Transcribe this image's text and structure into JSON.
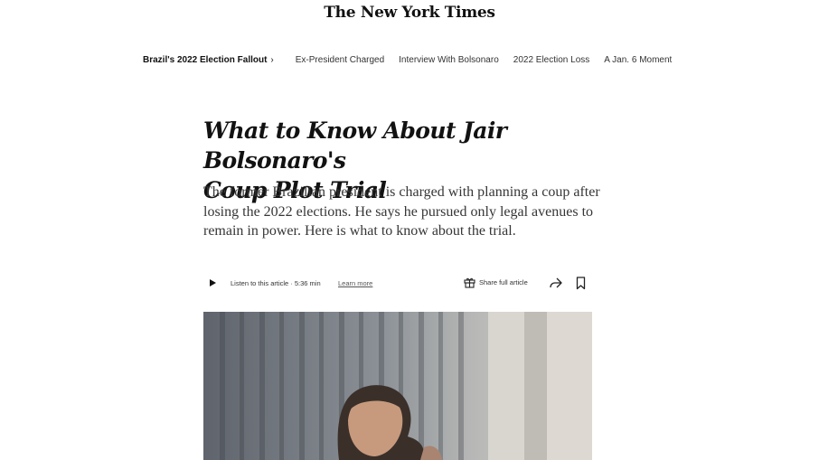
{
  "masthead": {
    "logo_text": "The New York Times"
  },
  "topic_bar": {
    "main_label": "Brazil's 2022 Election Fallout",
    "chevron": "›",
    "links": [
      "Ex-President Charged",
      "Interview With Bolsonaro",
      "2022 Election Loss",
      "A Jan. 6 Moment"
    ]
  },
  "article": {
    "headline_line1": "What to Know About Jair Bolsonaro's",
    "headline_line2": "Coup Plot Trial",
    "summary": "The former Brazilian president is charged with planning a coup after losing the 2022 elections. He says he pursued only legal avenues to remain in power. Here is what to know about the trial."
  },
  "toolbar": {
    "play_icon": "play-icon",
    "listen_label": "Listen to this article · 5:36 min",
    "learn_more": "Learn more",
    "share_full_label": "Share full article",
    "gift_icon": "gift-icon",
    "share_icon": "share-arrow-icon",
    "bookmark_icon": "bookmark-icon"
  },
  "photo": {
    "description_icon": "lead-photo"
  },
  "colors": {
    "text": "#121212",
    "secondary_text": "#363636",
    "background": "#ffffff"
  }
}
